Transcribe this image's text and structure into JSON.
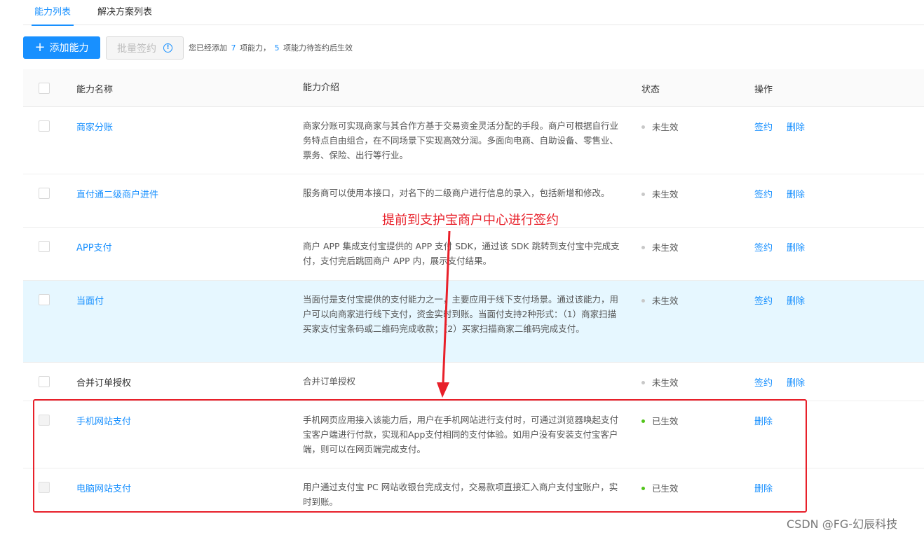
{
  "tabs": [
    {
      "label": "能力列表",
      "active": true
    },
    {
      "label": "解决方案列表",
      "active": false
    }
  ],
  "toolbar": {
    "add_label": "添加能力",
    "batch_sign_label": "批量签约",
    "summary_prefix": "您已经添加",
    "added_count": "7",
    "summary_mid": "项能力，",
    "pending_count": "5",
    "summary_suffix": "项能力待签约后生效"
  },
  "table": {
    "headers": {
      "name": "能力名称",
      "desc": "能力介绍",
      "status": "状态",
      "op": "操作"
    },
    "rows": [
      {
        "name": "商家分账",
        "desc": "商家分账可实现商家与其合作方基于交易资金灵活分配的手段。商户可根据自行业务特点自由组合，在不同场景下实现高效分润。多面向电商、自助设备、零售业、票务、保险、出行等行业。",
        "status": "未生效",
        "sign": "签约",
        "delete": "删除"
      },
      {
        "name": "直付通二级商户进件",
        "desc": "服务商可以使用本接口，对名下的二级商户进行信息的录入，包括新增和修改。",
        "status": "未生效",
        "sign": "签约",
        "delete": "删除"
      },
      {
        "name": "APP支付",
        "desc": "商户 APP 集成支付宝提供的 APP 支付 SDK，通过该 SDK 跳转到支付宝中完成支付，支付完后跳回商户 APP 内，展示支付结果。",
        "status": "未生效",
        "sign": "签约",
        "delete": "删除"
      },
      {
        "name": "当面付",
        "desc": "当面付是支付宝提供的支付能力之一，主要应用于线下支付场景。通过该能力，用户可以向商家进行线下支付，资金实时到账。当面付支持2种形式：（1）商家扫描买家支付宝条码或二维码完成收款；（2）买家扫描商家二维码完成支付。",
        "status": "未生效",
        "sign": "签约",
        "delete": "删除"
      },
      {
        "name": "合并订单授权",
        "desc": "合并订单授权",
        "status": "未生效",
        "sign": "签约",
        "delete": "删除"
      },
      {
        "name": "手机网站支付",
        "desc": "手机网页应用接入该能力后，用户在手机网站进行支付时，可通过浏览器唤起支付宝客户端进行付款，实现和App支付相同的支付体验。如用户没有安装支付宝客户端，则可以在网页端完成支付。",
        "status": "已生效",
        "delete": "删除"
      },
      {
        "name": "电脑网站支付",
        "desc": "用户通过支付宝 PC 网站收银台完成支付，交易款项直接汇入商户支付宝账户，实时到账。",
        "status": "已生效",
        "delete": "删除"
      }
    ]
  },
  "annotation": {
    "text": "提前到支护宝商户中心进行签约",
    "color": "#e8202a"
  },
  "watermark": "CSDN @FG-幻辰科技",
  "colors": {
    "accent": "#1890ff",
    "active_status": "#52c41a",
    "inactive_status": "#c8c8c8",
    "highlight_row": "#e6f7ff"
  }
}
